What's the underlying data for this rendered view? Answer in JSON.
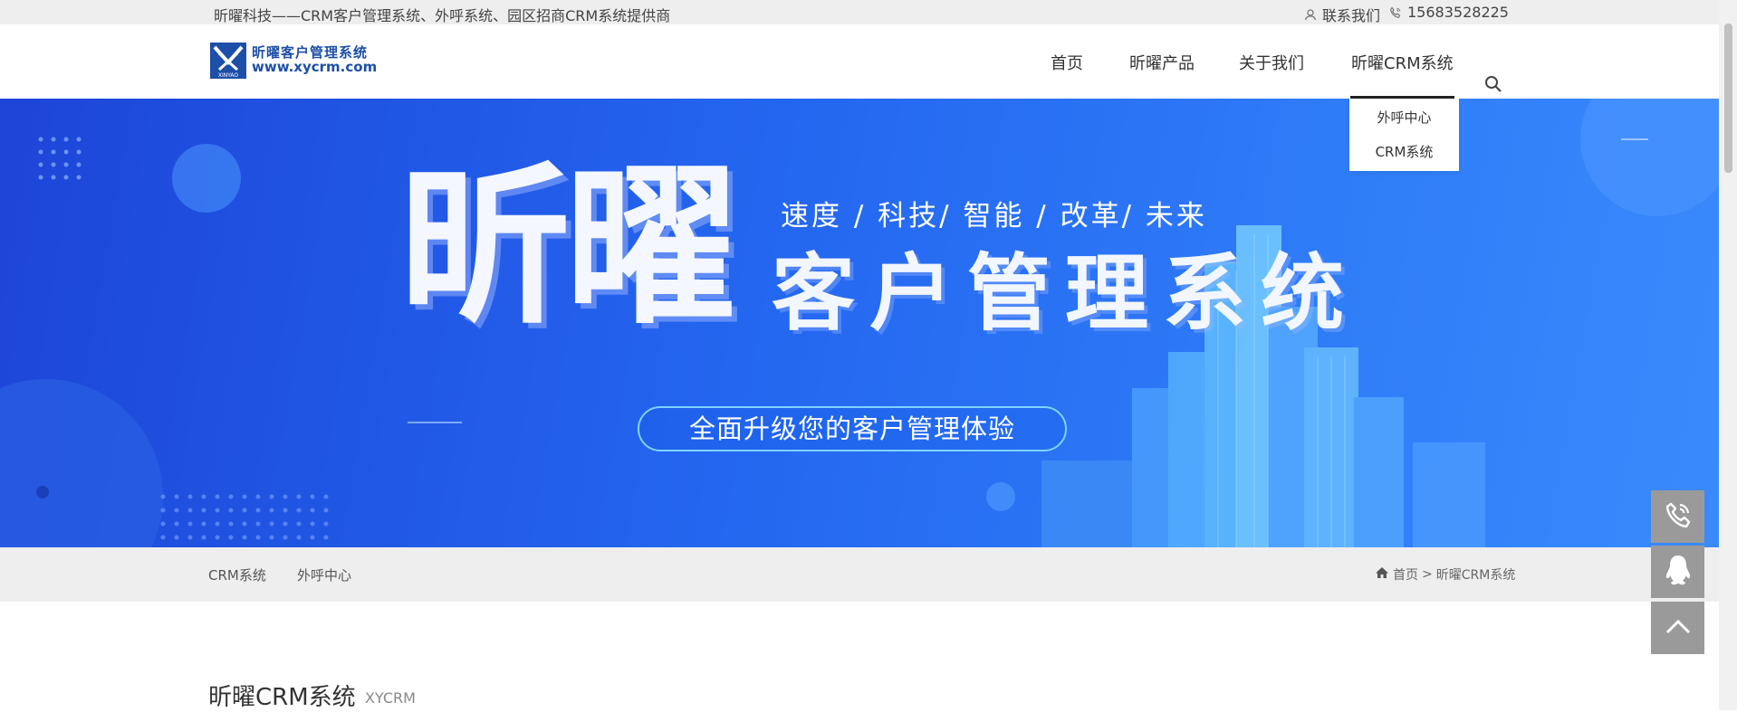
{
  "topbar": {
    "slogan": "昕曜科技——CRM客户管理系统、外呼系统、园区招商CRM系统提供商",
    "contact_label": "联系我们",
    "phone": "15683528225",
    "contact_icon": "user-icon",
    "phone_icon": "phone-icon"
  },
  "header": {
    "logo": {
      "name": "昕曜客户管理系统",
      "url": "www.xycrm.com",
      "mark_text": "XINYAO",
      "brand_color": "#1d4fa8"
    },
    "nav": [
      {
        "label": "首页"
      },
      {
        "label": "昕曜产品"
      },
      {
        "label": "关于我们"
      },
      {
        "label": "昕曜CRM系统",
        "active": true
      }
    ],
    "search_icon": "search-icon",
    "dropdown": [
      {
        "label": "外呼中心"
      },
      {
        "label": "CRM系统"
      }
    ]
  },
  "banner": {
    "big_title": "昕曜",
    "tagline": "速度 / 科技/ 智能 / 改革/ 未来",
    "sub_title": "客户管理系统",
    "pill": "全面升级您的客户管理体验",
    "colors": {
      "start": "#1d45d8",
      "end": "#3a8afc"
    }
  },
  "subnav": {
    "links": [
      {
        "label": "CRM系统"
      },
      {
        "label": "外呼中心"
      }
    ],
    "breadcrumb": {
      "home": "首页",
      "separator": ">",
      "current": "昕曜CRM系统",
      "icon": "home-icon"
    }
  },
  "section": {
    "title": "昕曜CRM系统",
    "subtitle": "XYCRM"
  },
  "side_buttons": [
    {
      "icon": "phone-call-icon"
    },
    {
      "icon": "qq-penguin-icon"
    },
    {
      "icon": "chevron-up-icon"
    }
  ]
}
